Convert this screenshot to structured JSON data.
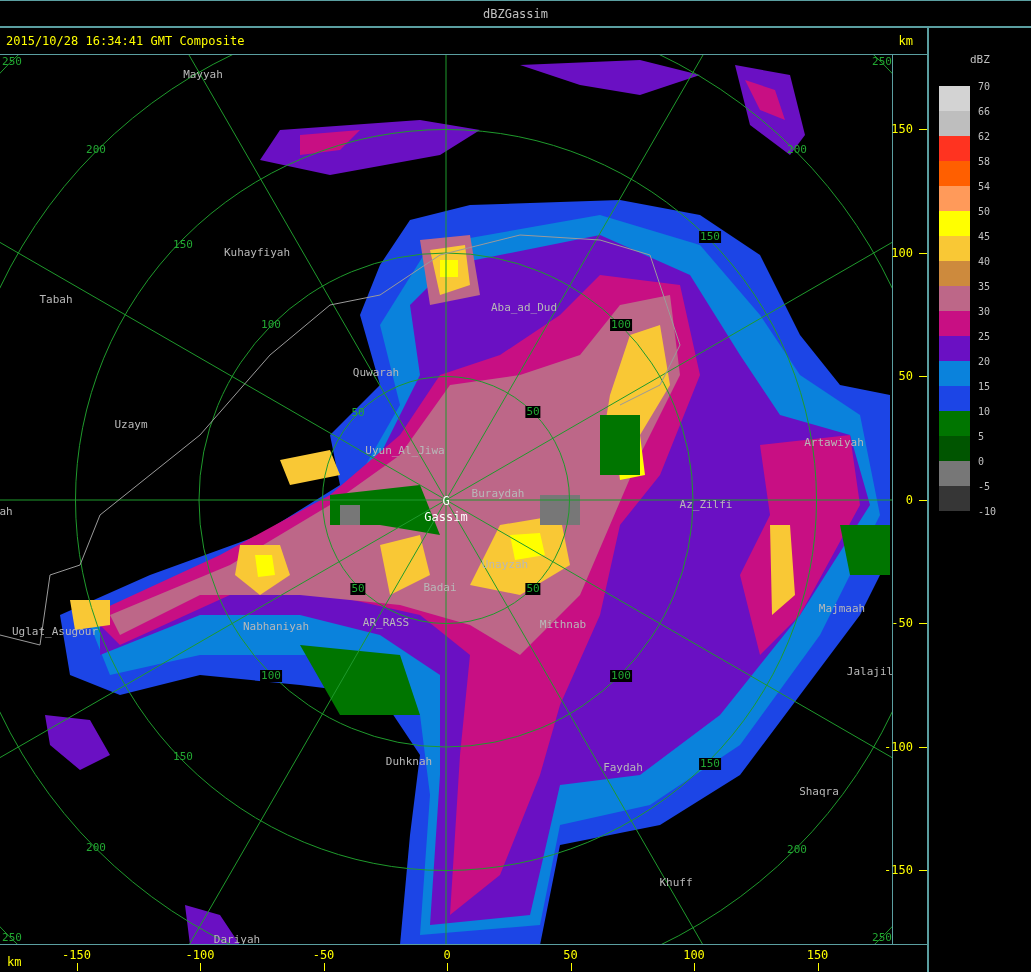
{
  "window": {
    "title": "dBZGassim"
  },
  "header": {
    "timestamp": "2015/10/28 16:34:41 GMT Composite",
    "unit": "km"
  },
  "map": {
    "place_labels": [
      {
        "text": "Mayyah",
        "kind": "place"
      },
      {
        "text": "Kuhayfiyah",
        "kind": "place"
      },
      {
        "text": "Tabah",
        "kind": "place"
      },
      {
        "text": "Aba_ad_Dud",
        "kind": "place"
      },
      {
        "text": "Quwarah",
        "kind": "place"
      },
      {
        "text": "Uzaym",
        "kind": "place"
      },
      {
        "text": "Uyun_Al_Jiwa",
        "kind": "place"
      },
      {
        "text": "Buraydah",
        "kind": "place"
      },
      {
        "text": "G",
        "kind": "station"
      },
      {
        "text": "Gassim",
        "kind": "station"
      },
      {
        "text": "ah",
        "kind": "place"
      },
      {
        "text": "Az_Zilfi",
        "kind": "place"
      },
      {
        "text": "Artawiyah",
        "kind": "place"
      },
      {
        "text": "Unayzah",
        "kind": "place"
      },
      {
        "text": "Badai",
        "kind": "place"
      },
      {
        "text": "Uglat_Asugour",
        "kind": "place"
      },
      {
        "text": "Nabhaniyah",
        "kind": "place"
      },
      {
        "text": "AR_RASS",
        "kind": "place"
      },
      {
        "text": "Mithnab",
        "kind": "place"
      },
      {
        "text": "Majmaah",
        "kind": "place"
      },
      {
        "text": "Jalajil",
        "kind": "place"
      },
      {
        "text": "Duhknah",
        "kind": "place"
      },
      {
        "text": "Faydah",
        "kind": "place"
      },
      {
        "text": "Shaqra",
        "kind": "place"
      },
      {
        "text": "Khuff",
        "kind": "place"
      },
      {
        "text": "Dariyah",
        "kind": "place"
      }
    ],
    "range_labels": [
      {
        "text": "250",
        "boxed": false
      },
      {
        "text": "250",
        "boxed": false
      },
      {
        "text": "200",
        "boxed": false
      },
      {
        "text": "200",
        "boxed": false
      },
      {
        "text": "150",
        "boxed": false
      },
      {
        "text": "150",
        "boxed": true
      },
      {
        "text": "100",
        "boxed": false
      },
      {
        "text": "100",
        "boxed": true
      },
      {
        "text": "50",
        "boxed": false
      },
      {
        "text": "50",
        "boxed": true
      },
      {
        "text": "50",
        "boxed": true
      },
      {
        "text": "50",
        "boxed": true
      },
      {
        "text": "100",
        "boxed": true
      },
      {
        "text": "100",
        "boxed": true
      },
      {
        "text": "150",
        "boxed": false
      },
      {
        "text": "150",
        "boxed": true
      },
      {
        "text": "200",
        "boxed": false
      },
      {
        "text": "200",
        "boxed": false
      },
      {
        "text": "250",
        "boxed": false
      },
      {
        "text": "250",
        "boxed": false
      }
    ]
  },
  "y_axis": {
    "ticks": [
      "150",
      "100",
      "50",
      "0",
      "-50",
      "-100",
      "-150"
    ]
  },
  "x_axis": {
    "unit": "km",
    "ticks": [
      "-150",
      "-100",
      "-50",
      "0",
      "50",
      "100",
      "150"
    ]
  },
  "legend": {
    "title": "dBZ",
    "labels": [
      "70",
      "66",
      "62",
      "58",
      "54",
      "50",
      "45",
      "40",
      "35",
      "30",
      "25",
      "20",
      "15",
      "10",
      "5",
      "0",
      "-5",
      "-10"
    ],
    "bins": [
      {
        "color": "#d3d3d3"
      },
      {
        "color": "#bebebe"
      },
      {
        "color": "#ff3320"
      },
      {
        "color": "#ff5f00"
      },
      {
        "color": "#ff9a5a"
      },
      {
        "color": "#ffff00"
      },
      {
        "color": "#f9c835"
      },
      {
        "color": "#cd8a3d"
      },
      {
        "color": "#bd6788"
      },
      {
        "color": "#c80f83"
      },
      {
        "color": "#6a10c3"
      },
      {
        "color": "#0a82dc"
      },
      {
        "color": "#1c45e6"
      },
      {
        "color": "#007500"
      },
      {
        "color": "#005500"
      },
      {
        "color": "#777777"
      },
      {
        "color": "#363636"
      }
    ]
  }
}
